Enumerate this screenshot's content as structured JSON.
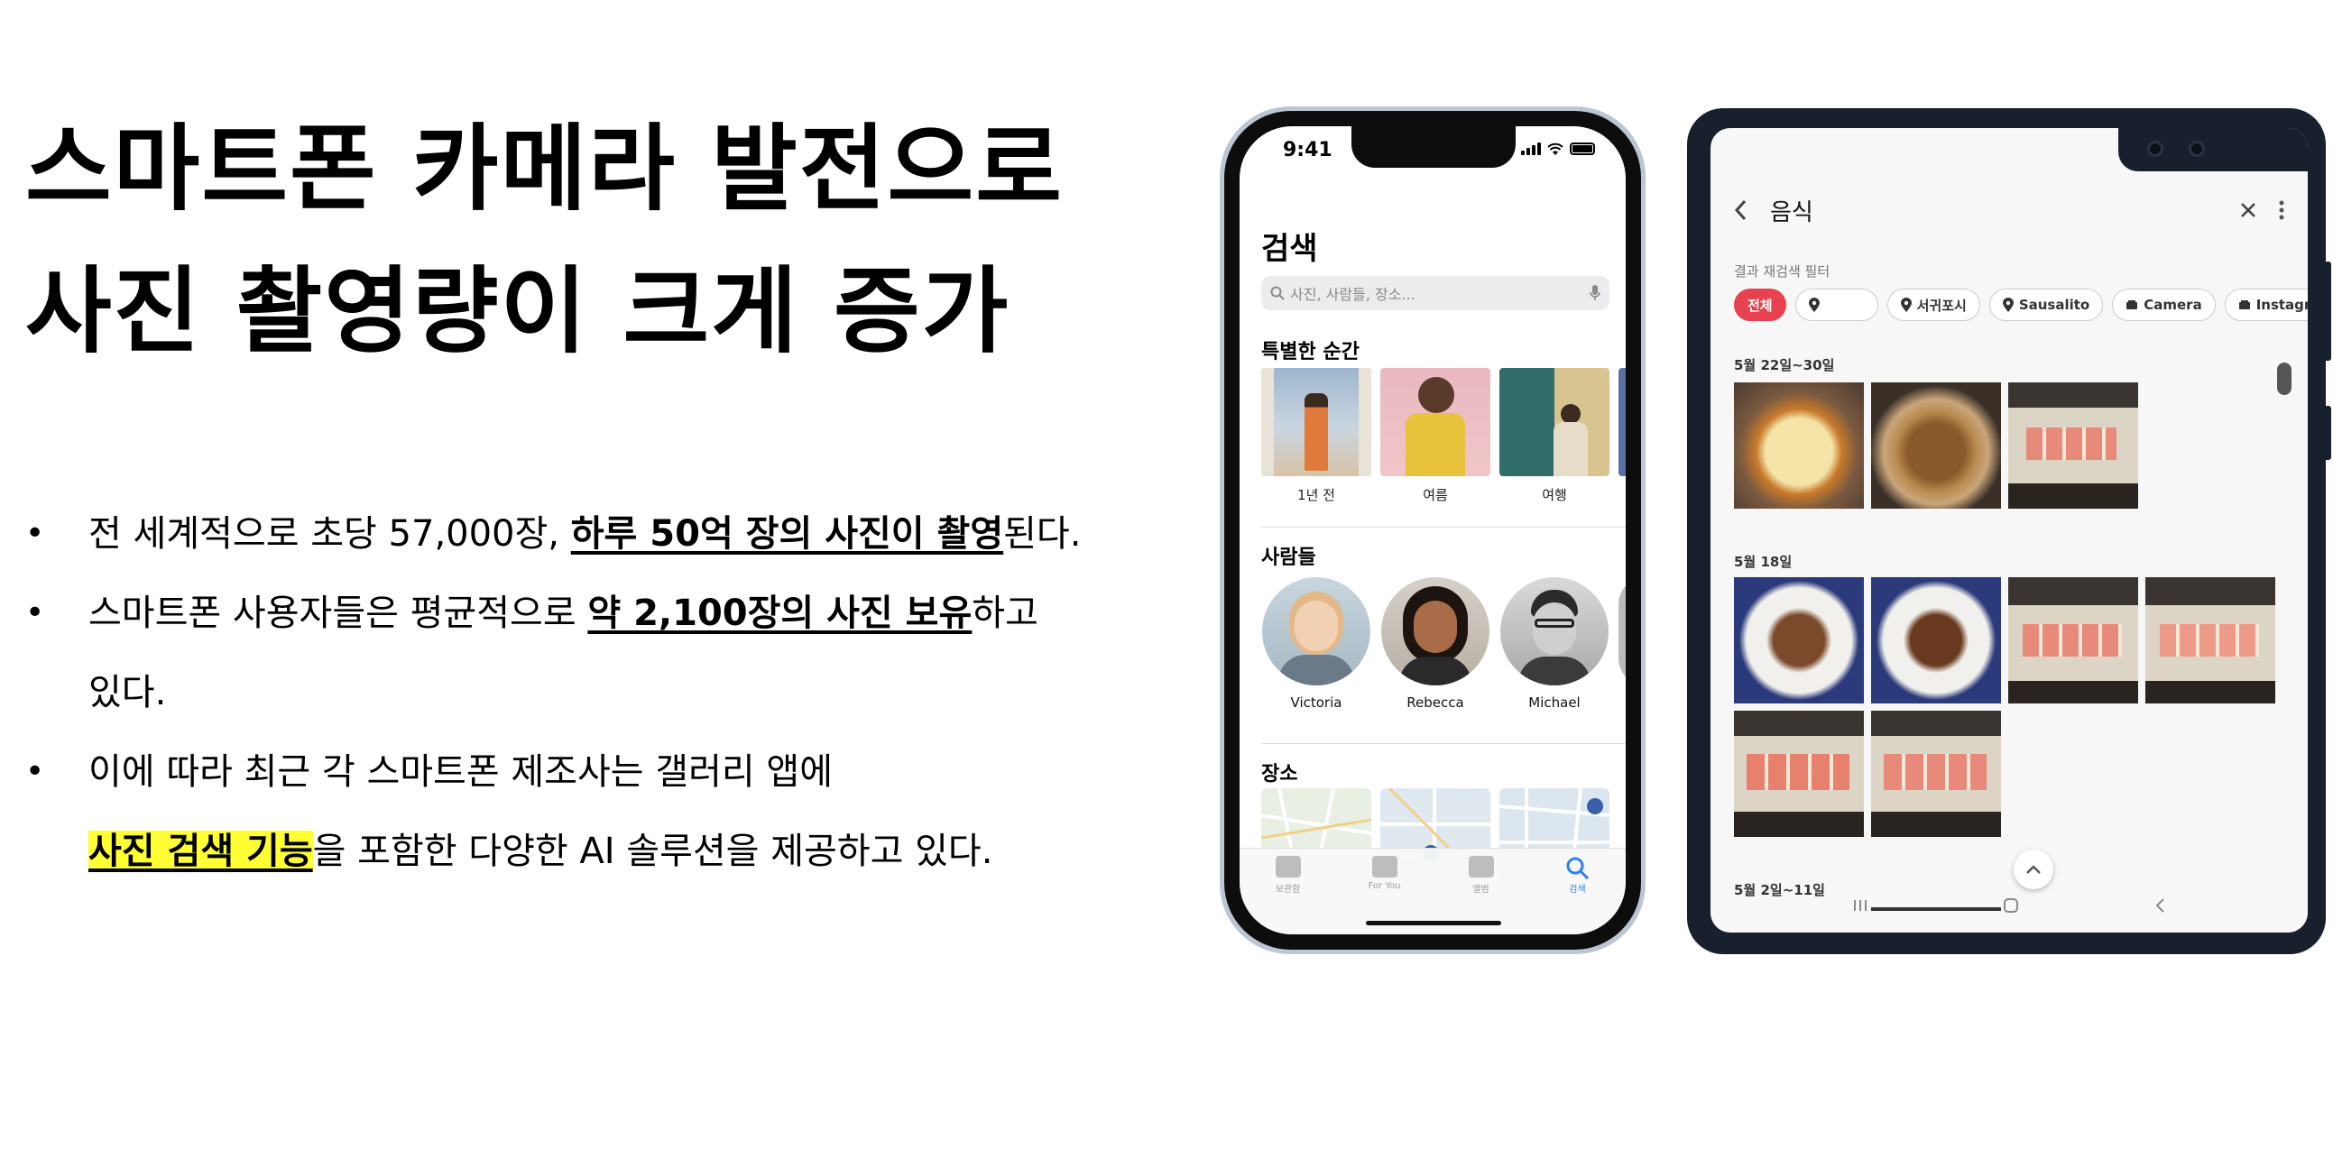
{
  "slide": {
    "title_lines": [
      "스마트폰 카메라 발전으로",
      "사진 촬영량이 크게 증가"
    ],
    "bullets": [
      {
        "pre": "전 세계적으로 초당 57,000장, ",
        "em": "하루 50억 장의 사진이 촬영",
        "post": "된다."
      },
      {
        "pre": "스마트폰 사용자들은 평균적으로 ",
        "em": "약 2,100장의 사진 보유",
        "post": "하고",
        "cont": "있다."
      },
      {
        "pre": "이에 따라 최근 각 스마트폰 제조사는 갤러리 앱에",
        "highlight": "사진 검색 기능",
        "post2": "을 포함한 다양한 AI 솔루션을 제공하고 있다."
      }
    ],
    "bullet_glyph": "•"
  },
  "iphone": {
    "time": "9:41",
    "title": "검색",
    "search_placeholder": "사진, 사람들, 장소...",
    "sections": {
      "moments": "특별한 순간",
      "people": "사람들",
      "places": "장소"
    },
    "moments": [
      "1년 전",
      "여름",
      "여행"
    ],
    "people": [
      "Victoria",
      "Rebecca",
      "Michael"
    ],
    "tabs": [
      "보관함",
      "For You",
      "앨범",
      "검색"
    ],
    "active_tab": "검색",
    "accent_color": "#2f7cf6"
  },
  "galaxy": {
    "query": "음식",
    "filter_label": "결과 재검색 필터",
    "chips": [
      "전체",
      "",
      "서귀포시",
      "Sausalito",
      "Camera",
      "Instagram"
    ],
    "dates": [
      "5월 22일~30일",
      "5월 18일",
      "5월 2일~11일"
    ],
    "accent_color": "#e8414f"
  }
}
